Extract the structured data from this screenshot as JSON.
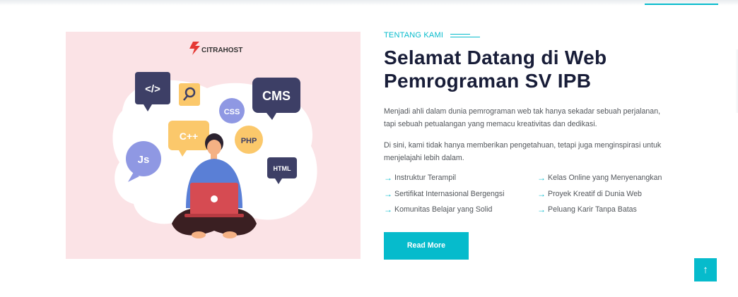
{
  "illustration": {
    "brand_logo_text": "CITRAHOST",
    "bubbles": {
      "code": "</>",
      "cms": "CMS",
      "css": "CSS",
      "cpp": "C++",
      "php": "PHP",
      "js": "Js",
      "html": "HTML"
    }
  },
  "about": {
    "eyebrow": "TENTANG KAMI",
    "title_line1": "Selamat Datang di Web",
    "title_line2": "Pemrograman SV IPB",
    "paragraph1": "Menjadi ahli dalam dunia pemrograman web tak hanya sekadar sebuah perjalanan, tapi sebuah petualangan yang memacu kreativitas dan dedikasi.",
    "paragraph2": "Di sini, kami tidak hanya memberikan pengetahuan, tetapi juga menginspirasi untuk menjelajahi lebih dalam.",
    "features": [
      "Instruktur Terampil",
      "Kelas Online yang Menyenangkan",
      "Sertifikat Internasional Bergengsi",
      "Proyek Kreatif di Dunia Web",
      "Komunitas Belajar yang Solid",
      "Peluang Karir Tanpa Batas"
    ],
    "read_more_label": "Read More"
  },
  "icons": {
    "feature_arrow": "arrow-right-icon",
    "back_to_top": "arrow-up-icon"
  },
  "colors": {
    "accent": "#06bbcc",
    "heading": "#181d38",
    "body_text": "#52565b",
    "image_background": "#fbe3e6"
  },
  "back_to_top_glyph": "↑"
}
